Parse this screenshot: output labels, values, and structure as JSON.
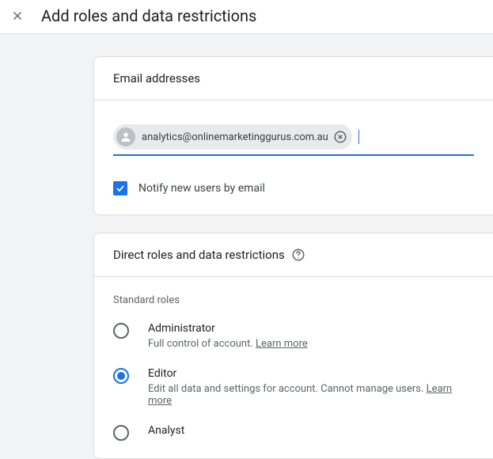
{
  "header": {
    "title": "Add roles and data restrictions"
  },
  "emailCard": {
    "heading": "Email addresses",
    "chip": {
      "email": "analytics@onlinemarketinggurus.com.au"
    },
    "notifyLabel": "Notify new users by email",
    "notifyChecked": true
  },
  "rolesCard": {
    "heading": "Direct roles and data restrictions",
    "sectionLabel": "Standard roles",
    "roles": [
      {
        "title": "Administrator",
        "description": "Full control of account. ",
        "learnMore": "Learn more",
        "selected": false
      },
      {
        "title": "Editor",
        "description": "Edit all data and settings for account. Cannot manage users. ",
        "learnMore": "Learn more",
        "selected": true
      },
      {
        "title": "Analyst",
        "description": "",
        "learnMore": "",
        "selected": false
      }
    ]
  }
}
